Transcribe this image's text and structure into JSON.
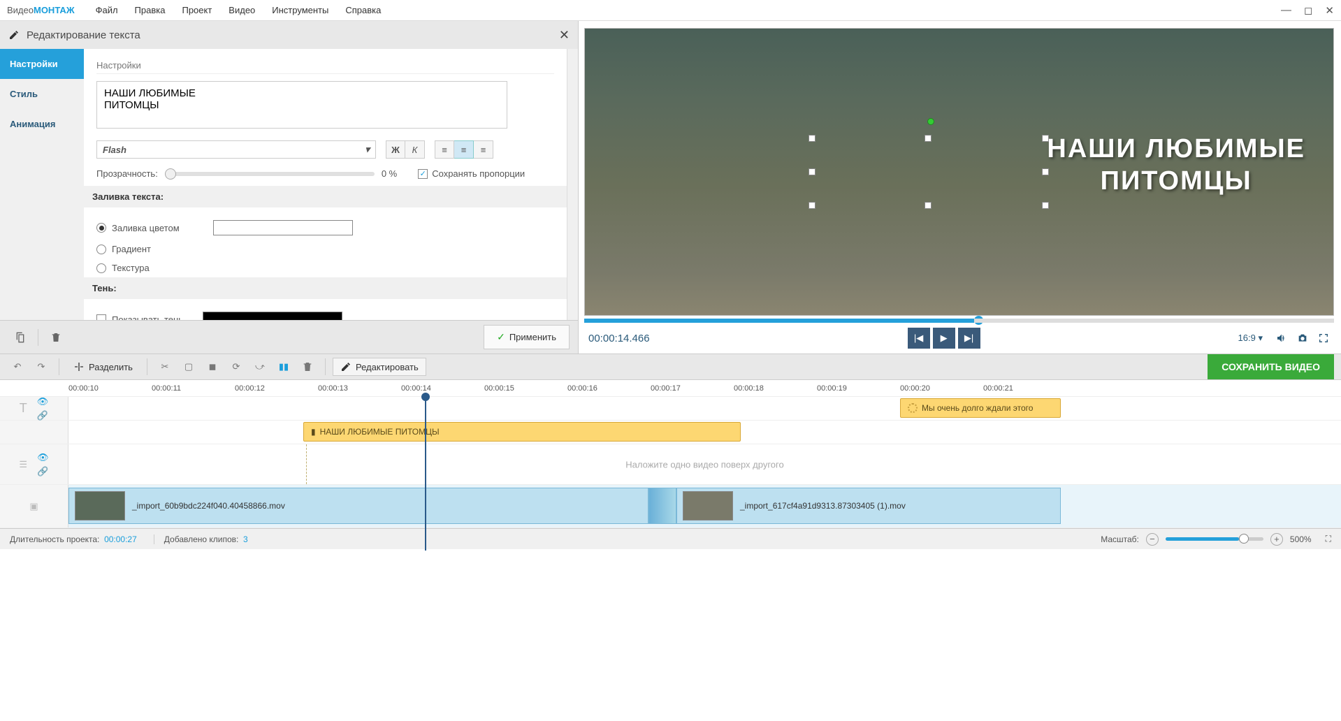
{
  "app": {
    "title_prefix": "Видео",
    "title_suffix": "МОНТАЖ"
  },
  "menu": [
    "Файл",
    "Правка",
    "Проект",
    "Видео",
    "Инструменты",
    "Справка"
  ],
  "panel": {
    "title": "Редактирование текста",
    "tabs": {
      "settings": "Настройки",
      "style": "Стиль",
      "animation": "Анимация"
    },
    "section_label": "Настройки",
    "text_value": "НАШИ ЛЮБИМЫЕ\nПИТОМЦЫ",
    "font_name": "Flash",
    "opacity_label": "Прозрачность:",
    "opacity_value": "0 %",
    "keep_ratio": "Сохранять пропорции",
    "fill_header": "Заливка текста:",
    "fill_color": "Заливка цветом",
    "fill_gradient": "Градиент",
    "fill_texture": "Текстура",
    "shadow_header": "Тень:",
    "shadow_show": "Показывать тень",
    "apply": "Применить"
  },
  "preview": {
    "overlay_line1": "НАШИ ЛЮБИМЫЕ",
    "overlay_line2": "ПИТОМЦЫ",
    "timecode": "00:00:14.466",
    "aspect": "16:9"
  },
  "toolbar": {
    "split": "Разделить",
    "edit": "Редактировать",
    "save": "СОХРАНИТЬ ВИДЕО"
  },
  "timeline": {
    "ticks": [
      "00:00:10",
      "00:00:11",
      "00:00:12",
      "00:00:13",
      "00:00:14",
      "00:00:15",
      "00:00:16",
      "00:00:17",
      "00:00:18",
      "00:00:19",
      "00:00:20",
      "00:00:21"
    ],
    "text_clip1": "НАШИ ЛЮБИМЫЕ  ПИТОМЦЫ",
    "text_clip2": "Мы очень долго   ждали этого",
    "overlay_hint": "Наложите одно видео поверх другого",
    "video_clip1": "_import_60b9bdc224f040.40458866.mov",
    "video_clip2": "_import_617cf4a91d9313.87303405 (1).mov"
  },
  "status": {
    "duration_label": "Длительность проекта:",
    "duration_value": "00:00:27",
    "clips_label": "Добавлено клипов:",
    "clips_value": "3",
    "zoom_label": "Масштаб:",
    "zoom_value": "500%"
  }
}
